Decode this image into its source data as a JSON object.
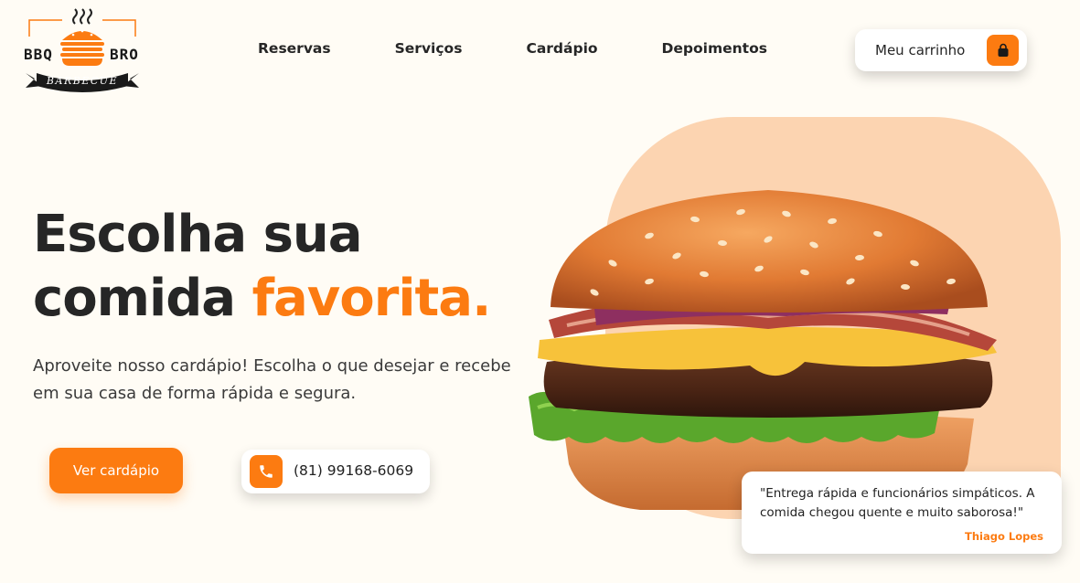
{
  "brand": {
    "left_text": "BBQ",
    "right_text": "BRO",
    "ribbon_text": "BARBECUE"
  },
  "nav": {
    "items": [
      "Reservas",
      "Serviços",
      "Cardápio",
      "Depoimentos"
    ]
  },
  "cart": {
    "label": "Meu carrinho",
    "icon": "shopping-bag-icon"
  },
  "hero": {
    "title_line1": "Escolha sua",
    "title_line2_plain": "comida ",
    "title_line2_accent": "favorita.",
    "subtitle": "Aproveite nosso cardápio! Escolha o que desejar e recebe em sua casa de forma rápida e segura.",
    "menu_button": "Ver cardápio",
    "phone": "(81) 99168-6069",
    "phone_icon": "phone-icon"
  },
  "testimonial": {
    "quote": "\"Entrega rápida e funcionários simpáticos. A comida chegou quente e muito saborosa!\"",
    "author": "Thiago Lopes"
  },
  "colors": {
    "accent": "#fc7b11",
    "background": "#fffcf5",
    "peach": "#fcd4b1",
    "text": "#262626"
  }
}
